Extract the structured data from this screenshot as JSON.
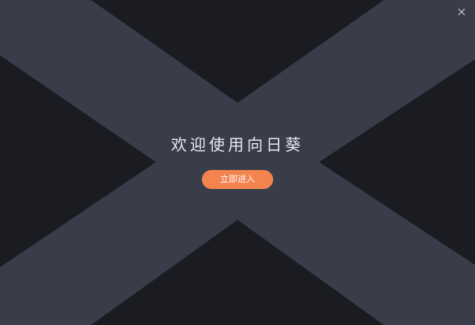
{
  "window": {
    "close_icon": "close-icon"
  },
  "welcome": {
    "title": "欢迎使用向日葵",
    "enter_label": "立即进入"
  },
  "colors": {
    "background": "#1b1c22",
    "x_band": "#393d49",
    "accent": "#f3834f",
    "title_text": "#e8e9ee",
    "close_icon": "#c9cbd3"
  }
}
